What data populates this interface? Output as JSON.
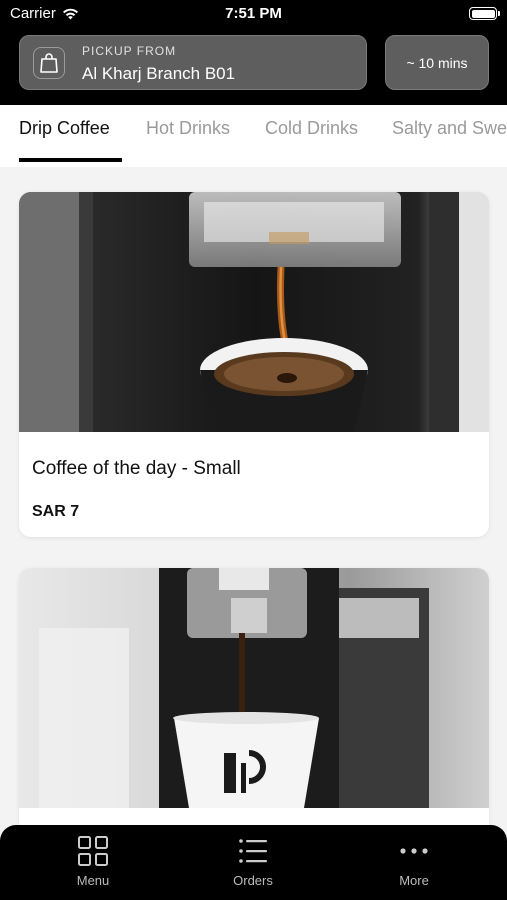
{
  "status_bar": {
    "carrier": "Carrier",
    "time": "7:51 PM"
  },
  "pickup": {
    "label": "PICKUP FROM",
    "branch": "Al Kharj Branch B01",
    "icon": "shopping-bag-icon"
  },
  "eta": {
    "label": "~ 10 mins"
  },
  "tabs": [
    {
      "label": "Drip Coffee",
      "active": true
    },
    {
      "label": "Hot Drinks",
      "active": false
    },
    {
      "label": "Cold Drinks",
      "active": false
    },
    {
      "label": "Salty and Swe",
      "active": false
    }
  ],
  "products": [
    {
      "title": "Coffee of the day - Small",
      "price": "SAR 7"
    },
    {
      "title": "",
      "price": ""
    }
  ],
  "nav": [
    {
      "label": "Menu",
      "icon": "grid-icon"
    },
    {
      "label": "Orders",
      "icon": "list-icon"
    },
    {
      "label": "More",
      "icon": "more-dots-icon"
    }
  ],
  "colors": {
    "header_bg": "#000000",
    "pill_bg": "#5e5e5e",
    "page_bg": "#f3f3f3",
    "active_tab": "#111111",
    "inactive_tab": "#9a9a9a"
  }
}
